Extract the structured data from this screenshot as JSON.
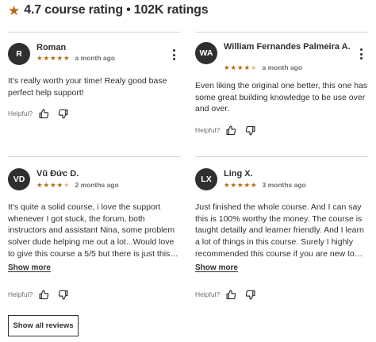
{
  "header": {
    "title": "4.7 course rating • 102K ratings"
  },
  "reviews": [
    {
      "initials": "R",
      "name": "Roman",
      "rating": 5,
      "date": "a month ago",
      "body": "It's really worth your time! Realy good base perfect help support!",
      "show_more": "",
      "helpful_label": "Helpful?"
    },
    {
      "initials": "WA",
      "name": "William Fernandes Palmeira A.",
      "rating": 4,
      "date": "a month ago",
      "body": "Even liking the original one better, this one has some great building knowledge to be use over and over.",
      "show_more": "",
      "helpful_label": "Helpful?"
    },
    {
      "initials": "VD",
      "name": "Vũ Đức D.",
      "rating": 4,
      "date": "2 months ago",
      "body": "It's quite a solid course, i love the support whenever I got stuck, the forum, both instructors and assistant Nina, some problem solver dude helping me out a lot...Would love to give this course a 5/5 but there is just this…",
      "show_more": "Show more",
      "helpful_label": "Helpful?"
    },
    {
      "initials": "LX",
      "name": "Ling X.",
      "rating": 5,
      "date": "3 months ago",
      "body": "Just finished the whole course. And I can say this is 100% worthy the money. The course is taught detailly and learner friendly. And I learn a lot of things in this course. Surely I highly recommended this course if you are new to…",
      "show_more": "Show more",
      "helpful_label": "Helpful?"
    }
  ],
  "show_all_label": "Show all reviews",
  "colors": {
    "star": "#b4690e",
    "text": "#2d2f31",
    "muted": "#6a6f73",
    "divider": "#d1d7dc"
  },
  "icons": {
    "header_star": "star-icon",
    "menu": "more-vertical-icon",
    "like": "thumbs-up-icon",
    "dislike": "thumbs-down-icon"
  }
}
